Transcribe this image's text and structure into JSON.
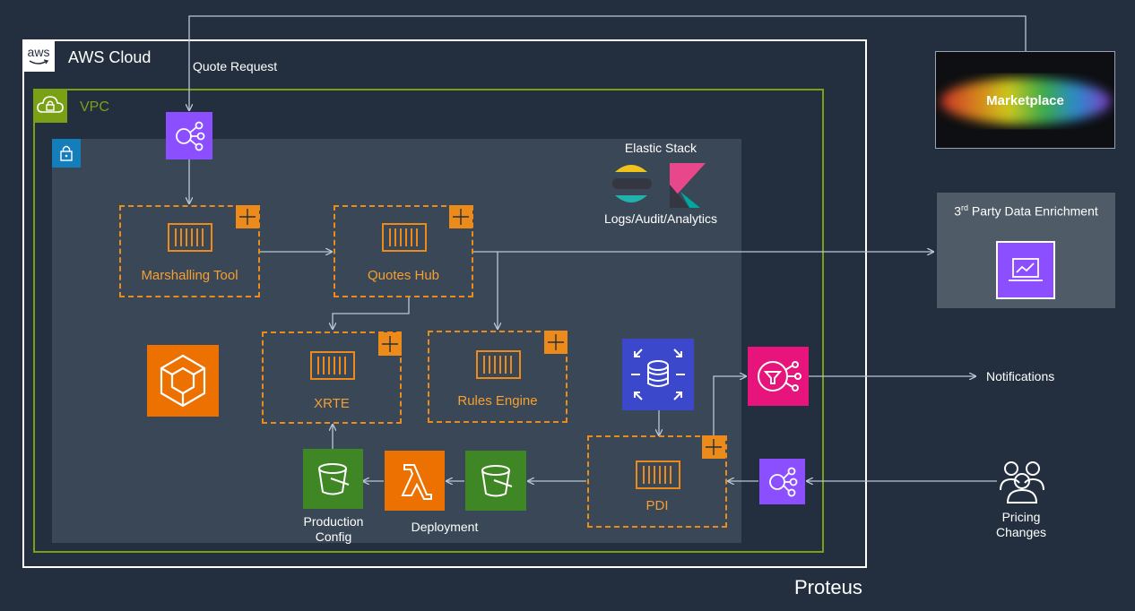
{
  "aws_cloud": {
    "label": "AWS Cloud",
    "logo_text": "aws"
  },
  "vpc": {
    "label": "VPC"
  },
  "quote_request": "Quote Request",
  "elastic_stack": {
    "title": "Elastic Stack",
    "subtitle": "Logs/Audit/Analytics"
  },
  "containers": {
    "marshalling_tool": "Marshalling Tool",
    "quotes_hub": "Quotes Hub",
    "xrte": "XRTE",
    "rules_engine": "Rules Engine",
    "pdi": "PDI"
  },
  "production_config": {
    "line1": "Production",
    "line2": "Config"
  },
  "deployment": "Deployment",
  "marketplace": "Marketplace",
  "third_party": {
    "prefix": "3",
    "sup": "rd",
    "rest": " Party Data Enrichment"
  },
  "notifications": "Notifications",
  "pricing_changes": {
    "line1": "Pricing",
    "line2": "Changes"
  },
  "project_name": "Proteus",
  "colors": {
    "background": "#232f3e",
    "subnet": "#3a4756",
    "vpc_border": "#7aa116",
    "container": "#ed8b1a",
    "event": "#8c4fff",
    "storage": "#3f8624",
    "compute": "#ed7100",
    "database": "#3b48cc",
    "messaging": "#e7157b"
  }
}
